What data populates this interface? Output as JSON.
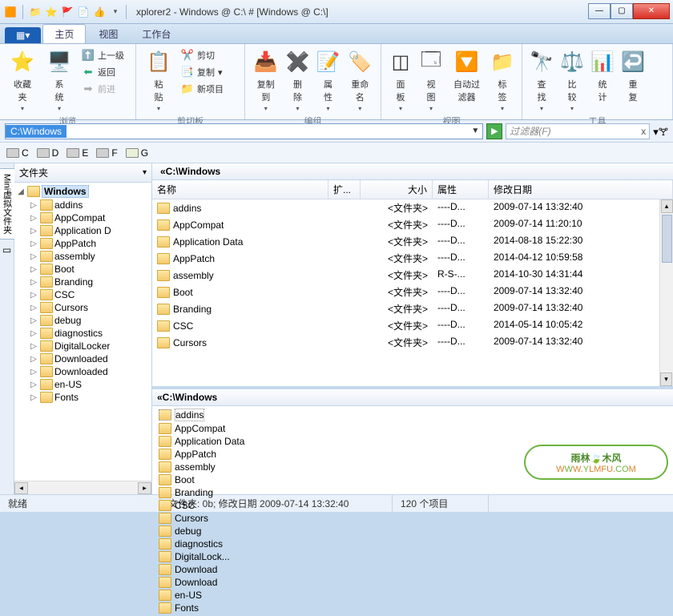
{
  "title": "xplorer2 - Windows @ C:\\ # [Windows @ C:\\]",
  "tabs": {
    "file": "▦▾",
    "home": "主页",
    "view": "视图",
    "workbench": "工作台"
  },
  "ribbon": {
    "browse": {
      "label": "浏览",
      "fav": "收藏\n夹",
      "sys": "系\n统",
      "up": "上一级",
      "back": "返回",
      "fwd": "前进"
    },
    "clipboard": {
      "label": "剪切板",
      "paste": "粘\n贴",
      "cut": "剪切",
      "copy": "复制",
      "new": "新项目"
    },
    "organize": {
      "label": "编组",
      "copyto": "复制\n到",
      "delete": "删\n除",
      "props": "属\n性",
      "rename": "重命\n名"
    },
    "viewg": {
      "label": "视图",
      "panel": "面\n板",
      "views": "视\n图",
      "autofilter": "自动过\n滤器",
      "bookmark": "标\n签"
    },
    "tools": {
      "label": "工具",
      "find": "查\n找",
      "compare": "比\n较",
      "stats": "统\n计",
      "undo": "重\n复"
    }
  },
  "address": {
    "path": "C:\\Windows",
    "filter_ph": "过滤器(F)"
  },
  "drives": [
    "C",
    "D",
    "E",
    "F",
    "G"
  ],
  "sidetab1": "Mini虚拟文件夹",
  "treehdr": "文件夹",
  "treeroot": "Windows",
  "tree": [
    "addins",
    "AppCompat",
    "Application D",
    "AppPatch",
    "assembly",
    "Boot",
    "Branding",
    "CSC",
    "Cursors",
    "debug",
    "diagnostics",
    "DigitalLocker",
    "Downloaded",
    "Downloaded",
    "en-US",
    "Fonts"
  ],
  "pane1_title": "«C:\\Windows",
  "cols": {
    "name": "名称",
    "ext": "扩...",
    "size": "大小",
    "attr": "属性",
    "date": "修改日期"
  },
  "rows": [
    {
      "n": "addins",
      "s": "<文件夹>",
      "a": "----D...",
      "d": "2009-07-14 13:32:40"
    },
    {
      "n": "AppCompat",
      "s": "<文件夹>",
      "a": "----D...",
      "d": "2009-07-14 11:20:10"
    },
    {
      "n": "Application Data",
      "s": "<文件夹>",
      "a": "----D...",
      "d": "2014-08-18 15:22:30"
    },
    {
      "n": "AppPatch",
      "s": "<文件夹>",
      "a": "----D...",
      "d": "2014-04-12 10:59:58"
    },
    {
      "n": "assembly",
      "s": "<文件夹>",
      "a": "R-S-...",
      "d": "2014-10-30 14:31:44"
    },
    {
      "n": "Boot",
      "s": "<文件夹>",
      "a": "----D...",
      "d": "2009-07-14 13:32:40"
    },
    {
      "n": "Branding",
      "s": "<文件夹>",
      "a": "----D...",
      "d": "2009-07-14 13:32:40"
    },
    {
      "n": "CSC",
      "s": "<文件夹>",
      "a": "----D...",
      "d": "2014-05-14 10:05:42"
    },
    {
      "n": "Cursors",
      "s": "<文件夹>",
      "a": "----D...",
      "d": "2009-07-14 13:32:40"
    }
  ],
  "pane2_title": "«C:\\Windows",
  "icons_col1": [
    "addins",
    "AppCompat",
    "Application Data",
    "AppPatch"
  ],
  "icons_col2": [
    "assembly",
    "Boot",
    "Branding",
    "CSC"
  ],
  "icons_col3": [
    "Cursors",
    "debug",
    "diagnostics",
    "DigitalLock..."
  ],
  "icons_col4": [
    "Download",
    "Download",
    "en-US",
    "Fonts"
  ],
  "status": {
    "ready": "就绪",
    "info": "文件夹: 0b; 修改日期 2009-07-14 13:32:40",
    "count": "120 个项目"
  },
  "watermark": {
    "t1": "雨林🍃木风",
    "t2": "WWW.YLMFU.COM"
  }
}
